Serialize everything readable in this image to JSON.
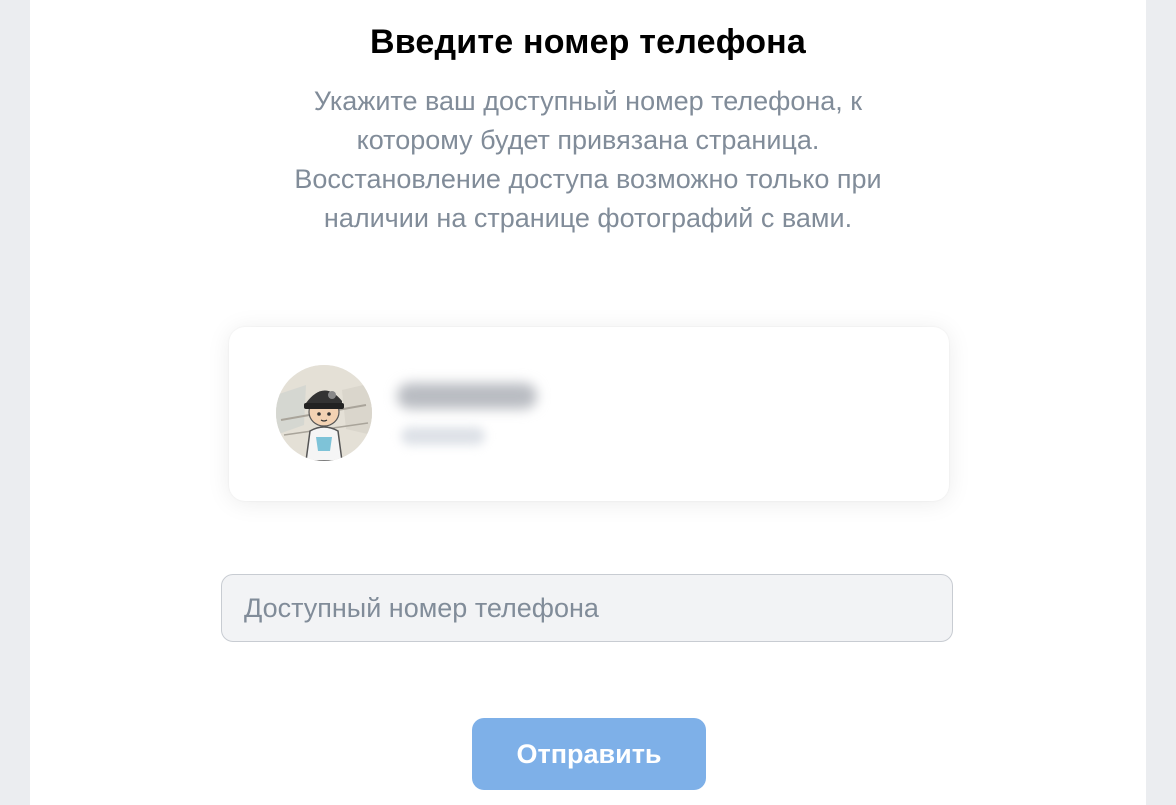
{
  "header": {
    "title": "Введите номер телефона",
    "description": "Укажите ваш доступный номер телефона, к которому будет привязана страница. Восстановление доступа возможно только при наличии на странице фотографий с вами."
  },
  "profile": {
    "avatar_icon": "user-avatar-cartoon-icon",
    "name_blurred": true
  },
  "form": {
    "phone_placeholder": "Доступный номер телефона",
    "phone_value": "",
    "submit_label": "Отправить"
  },
  "colors": {
    "page_background": "#ebedf0",
    "panel_background": "#ffffff",
    "muted_text": "#818c99",
    "input_background": "#f2f3f5",
    "button_disabled": "#7eb0e8"
  }
}
